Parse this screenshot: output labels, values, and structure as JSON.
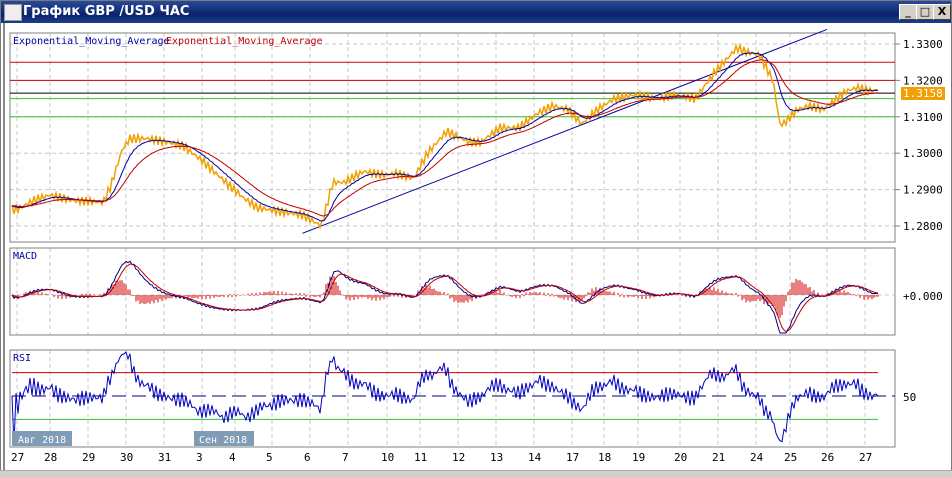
{
  "window": {
    "title": "График GBP /USD  ЧАС",
    "buttons": {
      "minimize": "_",
      "maximize": "□",
      "close": "X"
    }
  },
  "main_panel": {
    "legend": [
      {
        "label": "Exponential_Moving_Average",
        "color": "#0000a0"
      },
      {
        "label": "Exponential_Moving_Average",
        "color": "#c00000"
      }
    ],
    "price_ticks": [
      "1.3300",
      "1.3200",
      "1.3100",
      "1.3000",
      "1.2900",
      "1.2800"
    ],
    "current_price": "1.3158",
    "current_price_color": "#f0a000"
  },
  "macd_panel": {
    "label": "MACD",
    "zero_label": "+0.000"
  },
  "rsi_panel": {
    "label": "RSI",
    "mid_label": "50",
    "levels": [
      70,
      50,
      30
    ]
  },
  "time_axis": {
    "days": [
      "27",
      "28",
      "29",
      "30",
      "31",
      "3",
      "4",
      "5",
      "6",
      "7",
      "10",
      "11",
      "12",
      "13",
      "14",
      "17",
      "18",
      "19",
      "20",
      "21",
      "24",
      "25",
      "26",
      "27"
    ],
    "month_badges": [
      "Авг 2018",
      "Сен 2018"
    ]
  },
  "chart_data": {
    "type": "line",
    "title": "GBP/USD H1",
    "x_days": [
      0,
      0.5,
      1,
      1.6,
      2.4,
      2.6,
      2.9,
      3.1,
      3.6,
      4.1,
      4.5,
      5,
      5.6,
      6.2,
      6.6,
      7.2,
      7.8,
      8.3,
      8.6,
      8.9,
      9.4,
      9.9,
      10.3,
      10.8,
      11.2,
      11.7,
      12.3,
      12.6,
      13.1,
      13.6,
      14.1,
      14.5,
      14.9,
      15.3,
      15.8,
      16.3,
      16.9,
      17.4,
      17.9,
      18.4,
      18.9,
      19.5,
      19.7,
      20.1,
      20.5,
      20.7,
      20.8,
      21.2,
      21.5,
      21.9,
      22.5,
      22.8,
      23.2,
      23.7,
      24,
      24.3,
      24.5
    ],
    "prices": [
      1.2845,
      1.287,
      1.2885,
      1.287,
      1.2865,
      1.291,
      1.301,
      1.304,
      1.304,
      1.303,
      1.302,
      1.298,
      1.293,
      1.288,
      1.285,
      1.284,
      1.283,
      1.28,
      1.292,
      1.292,
      1.295,
      1.294,
      1.2945,
      1.293,
      1.3,
      1.306,
      1.303,
      1.303,
      1.307,
      1.307,
      1.311,
      1.313,
      1.312,
      1.308,
      1.312,
      1.315,
      1.316,
      1.315,
      1.316,
      1.315,
      1.322,
      1.329,
      1.328,
      1.327,
      1.32,
      1.308,
      1.308,
      1.312,
      1.313,
      1.312,
      1.317,
      1.318,
      1.317,
      1.319,
      1.317,
      1.316,
      1.3158
    ],
    "ylim": [
      1.275,
      1.333
    ],
    "horizontal_levels": [
      {
        "price": 1.325,
        "color": "#d00000"
      },
      {
        "price": 1.32,
        "color": "#d00000"
      },
      {
        "price": 1.3165,
        "color": "#000000"
      },
      {
        "price": 1.315,
        "color": "#30c030"
      },
      {
        "price": 1.31,
        "color": "#30c030"
      }
    ],
    "trendline": {
      "from": [
        7.8,
        1.278
      ],
      "to": [
        22,
        1.334
      ]
    }
  }
}
